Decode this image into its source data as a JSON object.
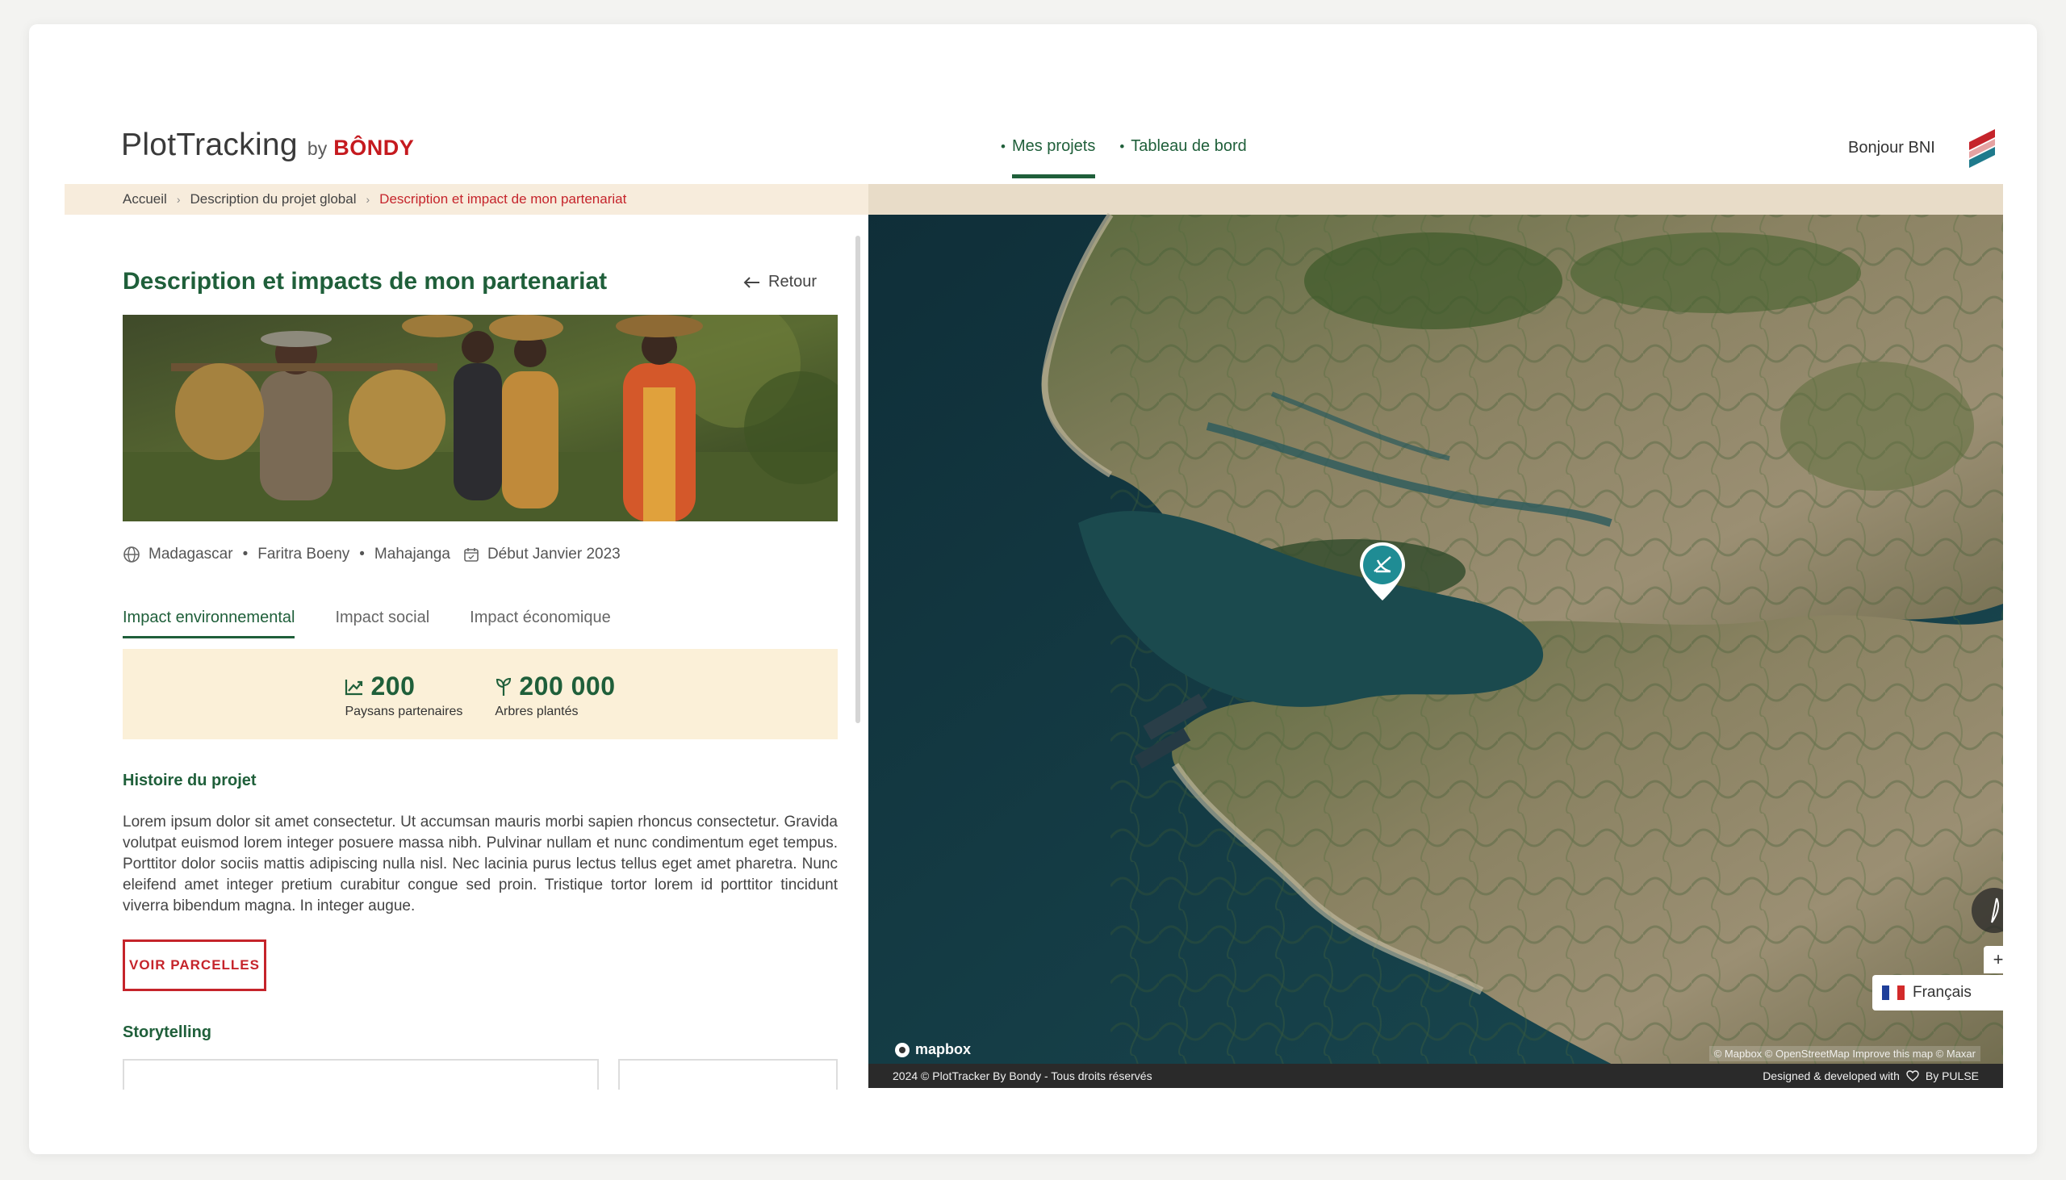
{
  "brand": {
    "name": "PlotTracking",
    "by": "by",
    "company": "BÔNDY"
  },
  "nav": {
    "items": [
      {
        "label": "Mes projets",
        "active": true
      },
      {
        "label": "Tableau de bord",
        "active": false
      }
    ]
  },
  "header": {
    "greeting": "Bonjour BNI"
  },
  "breadcrumb": {
    "items": [
      "Accueil",
      "Description du projet global",
      "Description et impact de mon partenariat"
    ]
  },
  "page": {
    "title": "Description et impacts de mon partenariat",
    "back_label": "Retour"
  },
  "meta": {
    "location": [
      "Madagascar",
      "Faritra Boeny",
      "Mahajanga"
    ],
    "separator": "•",
    "start": "Début Janvier 2023"
  },
  "tabs": [
    {
      "label": "Impact environnemental",
      "active": true
    },
    {
      "label": "Impact social",
      "active": false
    },
    {
      "label": "Impact économique",
      "active": false
    }
  ],
  "stats": [
    {
      "value": "200",
      "label": "Paysans partenaires",
      "icon": "trending-up-icon"
    },
    {
      "value": "200 000",
      "label": "Arbres plantés",
      "icon": "sprout-icon"
    }
  ],
  "history": {
    "title": "Histoire du projet",
    "text": "Lorem ipsum dolor sit amet consectetur. Ut accumsan mauris morbi sapien rhoncus consectetur. Gravida volutpat euismod lorem integer posuere massa nibh. Pulvinar nullam et nunc condimentum eget tempus. Porttitor dolor sociis mattis adipiscing nulla nisl. Nec lacinia purus lectus tellus eget amet pharetra. Nunc eleifend amet integer pretium curabitur congue sed proin. Tristique tortor lorem id porttitor tincidunt viverra bibendum magna. In integer augue."
  },
  "cta": {
    "label": "VOIR PARCELLES"
  },
  "storytelling": {
    "title": "Storytelling"
  },
  "map": {
    "zoom_in": "+",
    "zoom_out": "−",
    "language": "Français",
    "mapbox": "mapbox",
    "attribution": "© Mapbox © OpenStreetMap Improve this map © Maxar"
  },
  "footer": {
    "left": "2024 © PlotTracker By Bondy - Tous droits réservés",
    "right_prefix": "Designed & developed with",
    "right_suffix": "By PULSE"
  },
  "colors": {
    "primary_green": "#1f5f3a",
    "accent_red": "#c5242b",
    "breadcrumb_bg": "#f7ecdc",
    "stats_bg": "#fbf0d8"
  }
}
